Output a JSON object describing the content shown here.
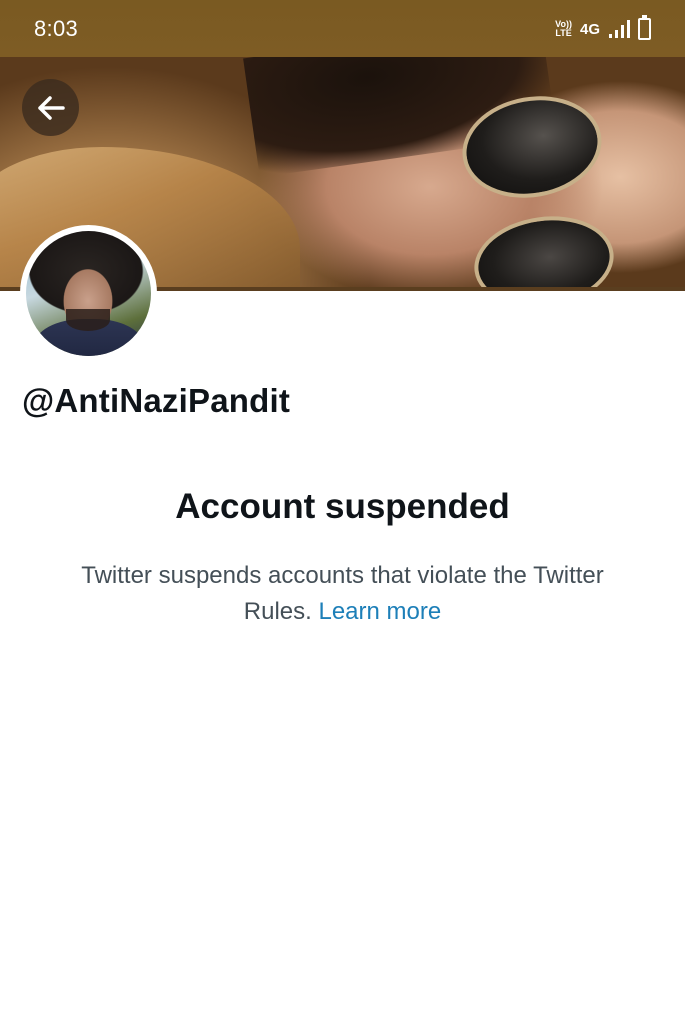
{
  "status_bar": {
    "time": "8:03",
    "volte_top": "Vo))",
    "volte_bottom": "LTE",
    "network": "4G",
    "signal_icon": "signal-bars-icon",
    "battery_icon": "battery-icon"
  },
  "header": {
    "back_icon": "arrow-left-icon"
  },
  "profile": {
    "username": "@AntiNaziPandit"
  },
  "suspension": {
    "title": "Account suspended",
    "description": "Twitter suspends accounts that violate the Twitter Rules.",
    "learn_more": "Learn more"
  },
  "colors": {
    "status_bar_bg": "#7e5c24",
    "link": "#1d7fb8",
    "text_primary": "#0f1419",
    "text_secondary": "#444f57"
  }
}
